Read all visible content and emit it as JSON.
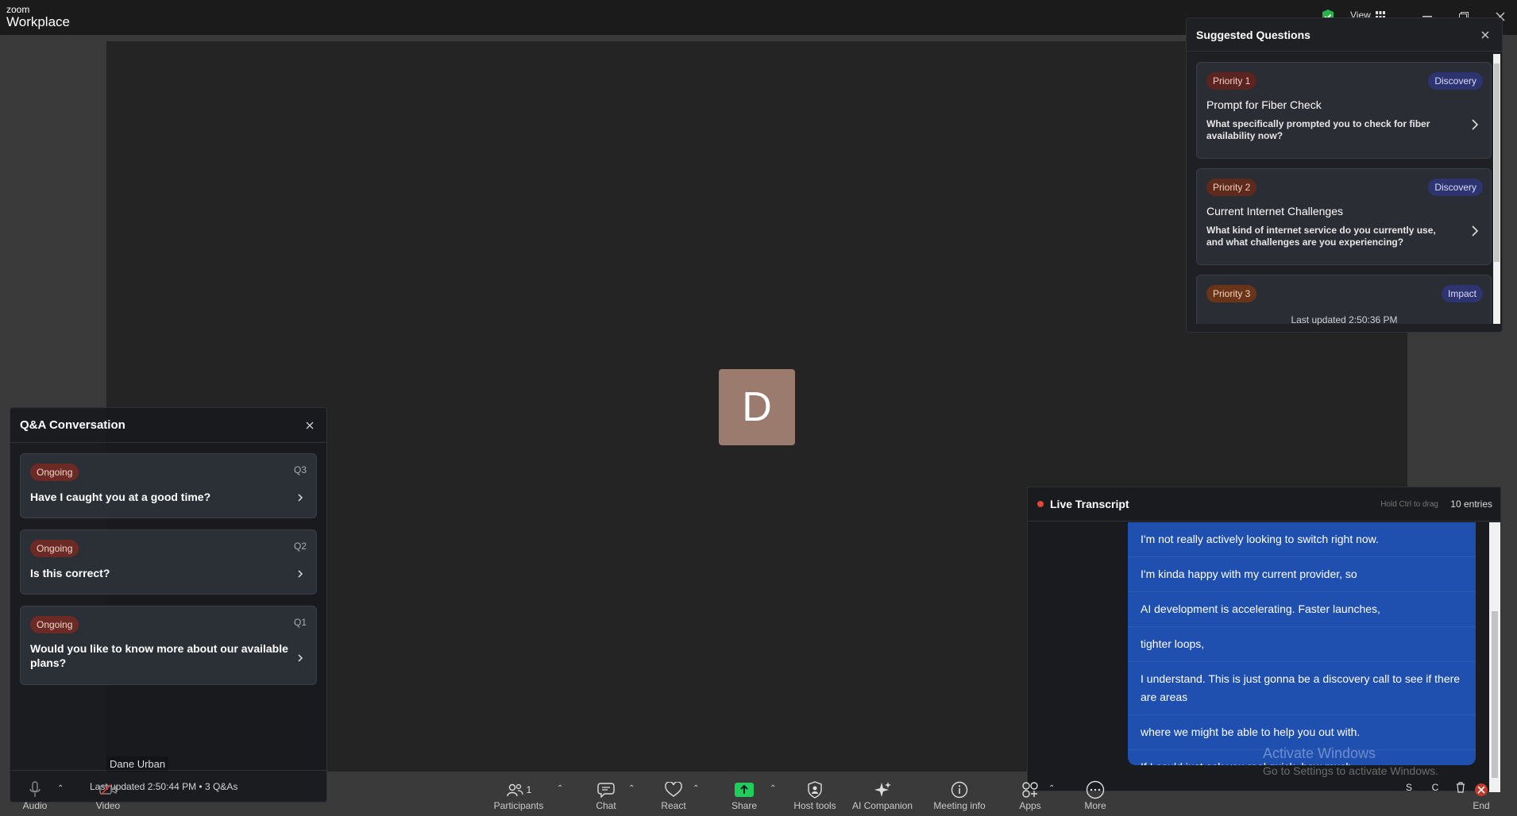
{
  "titlebar": {
    "brand_small": "zoom",
    "brand_big": "Workplace",
    "view_label": "View"
  },
  "meeting": {
    "avatar_letter": "D",
    "participant_name": "Dane Urban"
  },
  "qa": {
    "title": "Q&A Conversation",
    "items": [
      {
        "status": "Ongoing",
        "num": "Q3",
        "text": "Have I caught you at a good time?"
      },
      {
        "status": "Ongoing",
        "num": "Q2",
        "text": "Is this correct?"
      },
      {
        "status": "Ongoing",
        "num": "Q1",
        "text": "Would you like to know more about our available plans?"
      }
    ],
    "footer": "Last updated 2:50:44 PM • 3 Q&As"
  },
  "suggested": {
    "title": "Suggested Questions",
    "items": [
      {
        "priority": "Priority 1",
        "tag": "Discovery",
        "title": "Prompt for Fiber Check",
        "text": "What specifically prompted you to check for fiber availability now?"
      },
      {
        "priority": "Priority 2",
        "tag": "Discovery",
        "title": "Current Internet Challenges",
        "text": "What kind of internet service do you currently use, and what challenges are you experiencing?"
      },
      {
        "priority": "Priority 3",
        "tag": "Impact",
        "title": "",
        "text": ""
      }
    ],
    "footer": "Last updated 2:50:36 PM"
  },
  "transcript": {
    "title": "Live Transcript",
    "hint": "Hold Ctrl to drag",
    "count": "10 entries",
    "lines": [
      "I'm not really actively looking to switch right now.",
      "I'm kinda happy with my current provider, so",
      "AI development is accelerating. Faster launches,",
      "tighter loops,",
      "I understand. This is just gonna be a discovery call to see if there are areas",
      "where we might be able to help you out with.",
      "If I could just ask you real quick, how much"
    ]
  },
  "watermark": {
    "line1": "Activate Windows",
    "line2": "Go to Settings to activate Windows."
  },
  "toolbar": {
    "audio": "Audio",
    "video": "Video",
    "participants": "Participants",
    "participants_count": "1",
    "chat": "Chat",
    "react": "React",
    "share": "Share",
    "host_tools": "Host tools",
    "ai_companion": "AI Companion",
    "meeting_info": "Meeting info",
    "apps": "Apps",
    "more": "More",
    "end": "End",
    "mini_s": "S",
    "mini_c": "C"
  },
  "colors": {
    "share_green": "#1fce5a",
    "transcript_blue": "#1f4faf",
    "priority_red": "#5c2420",
    "discovery_blue": "#2e3470"
  }
}
